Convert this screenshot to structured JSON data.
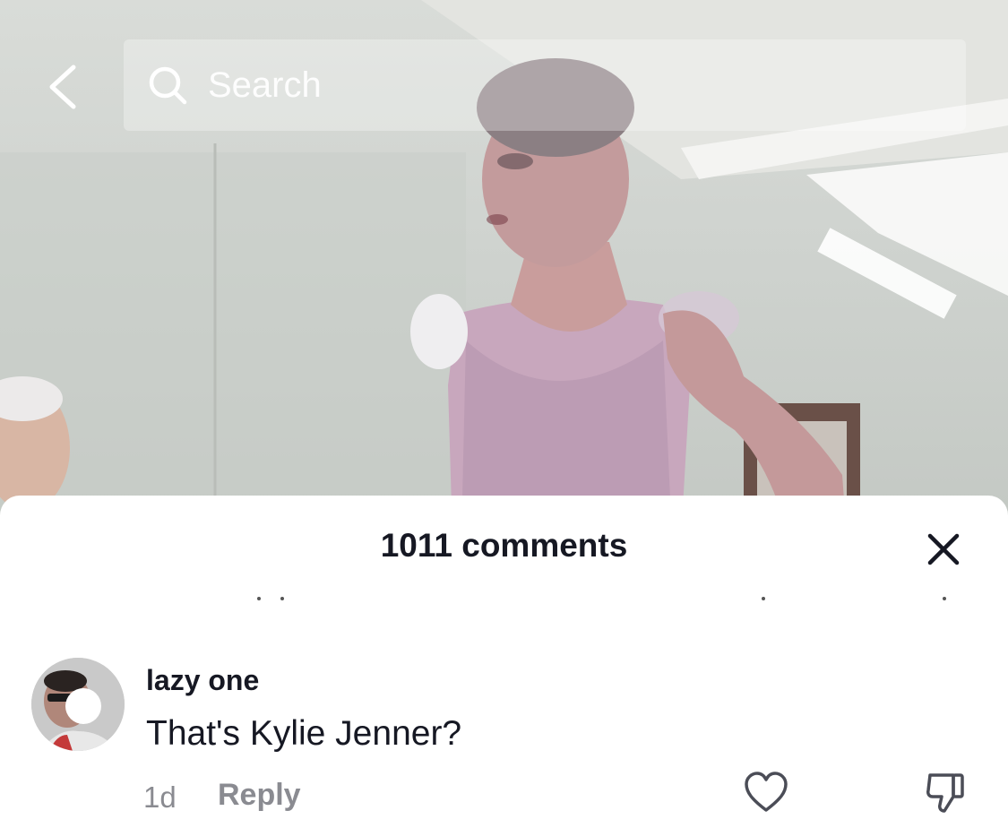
{
  "search": {
    "placeholder": "Search"
  },
  "icons": {
    "back": "chevron-left-icon",
    "search": "search-icon",
    "close": "close-icon",
    "like": "heart-icon",
    "dislike": "thumbs-down-icon"
  },
  "comments_panel": {
    "title": "1011 comments"
  },
  "comment": {
    "author": "lazy one",
    "text": "That's Kylie Jenner?",
    "time": "1d",
    "reply_label": "Reply"
  },
  "colors": {
    "text_primary": "#161823",
    "text_secondary": "#8a8b91",
    "sheet_background": "#ffffff"
  }
}
